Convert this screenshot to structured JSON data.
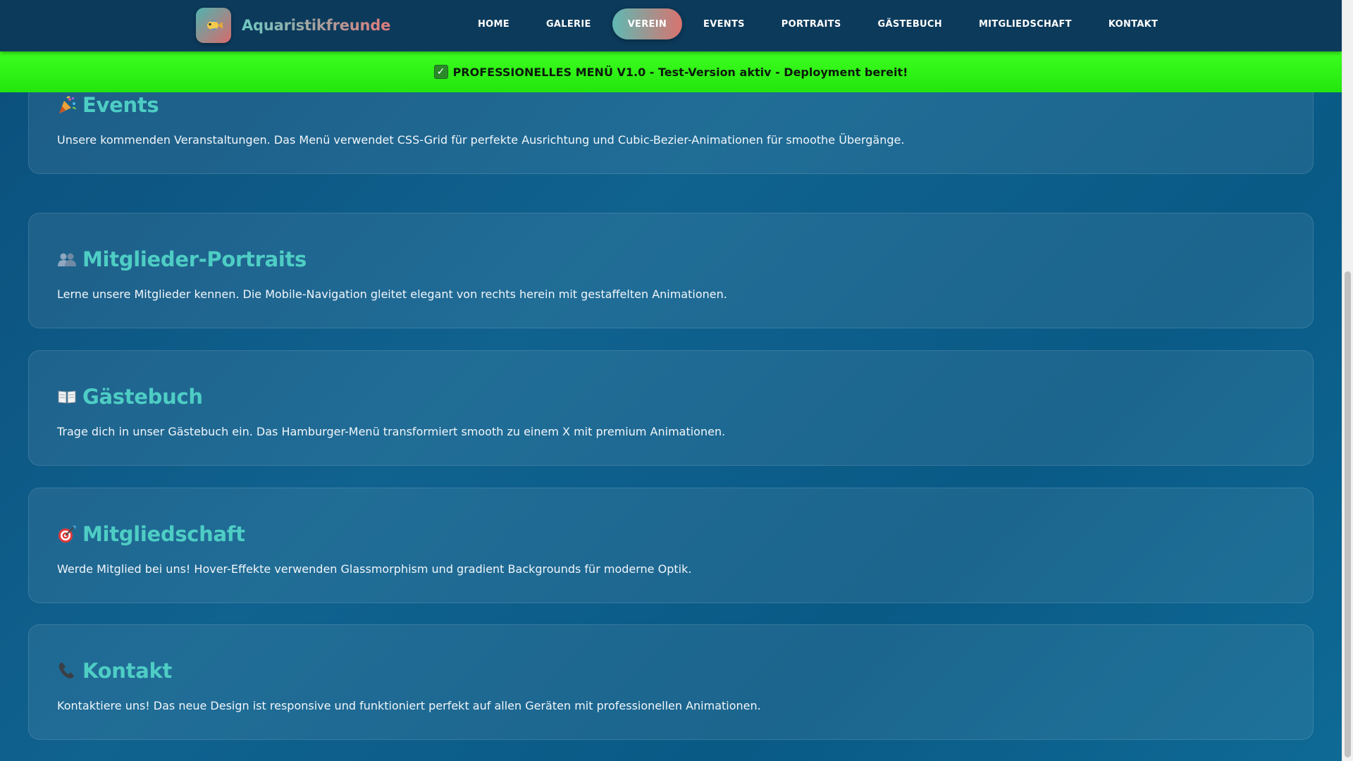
{
  "header": {
    "brand_name": "Aquaristikfreunde",
    "logo_icon": "fish-icon",
    "nav": [
      {
        "label": "HOME",
        "active": false
      },
      {
        "label": "GALERIE",
        "active": false
      },
      {
        "label": "VEREIN",
        "active": true
      },
      {
        "label": "EVENTS",
        "active": false
      },
      {
        "label": "PORTRAITS",
        "active": false
      },
      {
        "label": "GÄSTEBUCH",
        "active": false
      },
      {
        "label": "MITGLIEDSCHAFT",
        "active": false
      },
      {
        "label": "KONTAKT",
        "active": false
      }
    ]
  },
  "banner": {
    "icon": "check-icon",
    "text": "PROFESSIONELLES MENÜ V1.0 - Test-Version aktiv - Deployment bereit!",
    "color": "#2ef016"
  },
  "sections": [
    {
      "icon": "party-popper-icon",
      "title": "Events",
      "text": "Unsere kommenden Veranstaltungen. Das Menü verwendet CSS-Grid für perfekte Ausrichtung und Cubic-Bezier-Animationen für smoothe Übergänge."
    },
    {
      "icon": "people-icon",
      "title": "Mitglieder-Portraits",
      "text": "Lerne unsere Mitglieder kennen. Die Mobile-Navigation gleitet elegant von rechts herein mit gestaffelten Animationen."
    },
    {
      "icon": "book-icon",
      "title": "Gästebuch",
      "text": "Trage dich in unser Gästebuch ein. Das Hamburger-Menü transformiert smooth zu einem X mit premium Animationen."
    },
    {
      "icon": "target-icon",
      "title": "Mitgliedschaft",
      "text": "Werde Mitglied bei uns! Hover-Effekte verwenden Glassmorphism und gradient Backgrounds für moderne Optik."
    },
    {
      "icon": "phone-icon",
      "title": "Kontakt",
      "text": "Kontaktiere uns! Das neue Design ist responsive und funktioniert perfekt auf allen Geräten mit professionellen Animationen."
    }
  ],
  "colors": {
    "accent": "#4ecdc4",
    "header_bg": "#0c3a5b",
    "page_bg": "#0b4f7c"
  }
}
